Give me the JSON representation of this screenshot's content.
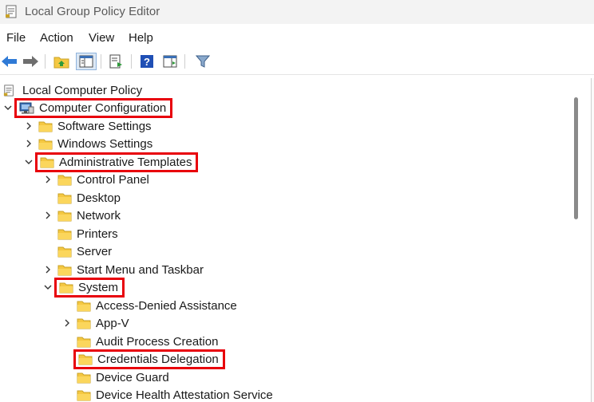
{
  "window": {
    "title": "Local Group Policy Editor"
  },
  "menu": {
    "file": "File",
    "action": "Action",
    "view": "View",
    "help": "Help"
  },
  "toolbar": {
    "icons": [
      "back-arrow-icon",
      "forward-arrow-icon",
      "up-folder-icon",
      "show-hide-tree-icon",
      "export-list-icon",
      "help-icon",
      "show-hide-action-pane-icon",
      "filter-icon"
    ]
  },
  "colors": {
    "highlight": "#e8000b",
    "folder": "#f5c842",
    "arrow": "#2f7ad6"
  },
  "tree": {
    "root": "Local Computer Policy",
    "computer_configuration": "Computer Configuration",
    "software_settings": "Software Settings",
    "windows_settings": "Windows Settings",
    "administrative_templates": "Administrative Templates",
    "control_panel": "Control Panel",
    "desktop": "Desktop",
    "network": "Network",
    "printers": "Printers",
    "server": "Server",
    "start_menu": "Start Menu and Taskbar",
    "system": "System",
    "access_denied": "Access-Denied Assistance",
    "app_v": "App-V",
    "audit_process": "Audit Process Creation",
    "credentials_delegation": "Credentials Delegation",
    "device_guard": "Device Guard",
    "device_health": "Device Health Attestation Service"
  }
}
